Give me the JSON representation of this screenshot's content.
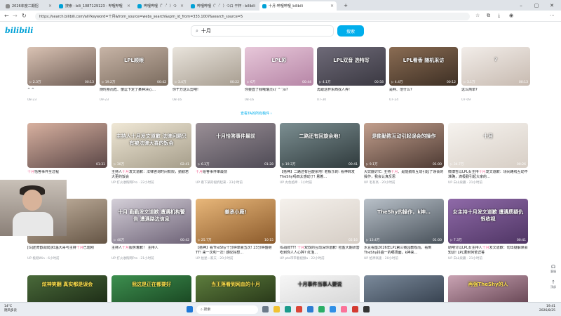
{
  "tabs": [
    {
      "label": "2026年度二期招",
      "color": "#8c8c8c"
    },
    {
      "label": "搜索 - bili_1087129123 - 哔哩哔哩",
      "color": "#00a1d6"
    },
    {
      "label": "哔哩哔哩（゜-゜）つ",
      "color": "#00a1d6"
    },
    {
      "label": "哔哩哔哩（゜-゜）つロ 干杯 - bilibili",
      "color": "#00a1d6"
    },
    {
      "label": "十月-哔哩哔哩_bilibili",
      "color": "#00a1d6"
    }
  ],
  "url": "https://search.bilibili.com/all?keyword=十月&from_source=webs_search&spm_id_from=333.1007&search_source=5",
  "logo": "bilibili",
  "search": {
    "query": "十月",
    "button": "搜索"
  },
  "row1": [
    {
      "title": "^ ^",
      "date": "08-23",
      "views": "2.3万",
      "dur": "00:13",
      "colors": [
        "#d9c2b3",
        "#6e5d55"
      ]
    },
    {
      "title": "随时身而危、傻逗下定了某种决心…",
      "date": "09-23",
      "views": "19.2万",
      "dur": "00:42",
      "colors": [
        "#c7b4a6",
        "#7a6b5e"
      ]
    },
    {
      "title": "你干万这么剪吧!",
      "date": "08-16",
      "views": "3.4万",
      "dur": "00:22",
      "colors": [
        "#e9e4dc",
        "#a79d90"
      ]
    },
    {
      "title": "你要直了我哦瑞灵ε(´^`)o?",
      "date": "08-16",
      "views": "6万",
      "dur": "00:44",
      "colors": [
        "#e7c7d9",
        "#b685a6"
      ]
    },
    {
      "title": "再跟这杯东西找人弄!",
      "date": "07-30",
      "views": "4.1万",
      "dur": "00:58",
      "colors": [
        "#6e6a78",
        "#3a3841"
      ]
    },
    {
      "title": "是啊、范什么?",
      "date": "07-24",
      "views": "4.4万",
      "dur": "00:12",
      "colors": [
        "#8a6c53",
        "#3d2f24"
      ]
    },
    {
      "title": "这么简单?",
      "date": "07-09",
      "views": "3.1万",
      "dur": "00:13",
      "colors": [
        "#f2ede9",
        "#c7bab0"
      ]
    }
  ],
  "row1_overlays": [
    "",
    "LPL顺眼",
    "",
    "LPL彩",
    "LPL双音 选特写",
    "LPL看香 随机采访",
    "?"
  ],
  "more_label": "查看TA的所有稿件 ›",
  "row2": [
    {
      "pre": "",
      "hl": "十月",
      "post": "恰答事件全过程",
      "uploader": "",
      "date": "",
      "views": "",
      "dur": "01:31",
      "ov": "",
      "colors": [
        "#d8b1a0",
        "#5a4646"
      ]
    },
    {
      "pre": "主持人",
      "hl": "十月",
      "post": "发文道歉：法律咨询时间有限，勤勤若大更的饭会",
      "uploader": "打火收购网Pro",
      "date": "22小时前",
      "views": "30万",
      "dur": "02:41",
      "ov": "主持人十月发文道歉 法律问题只有被法律大喜的饭会",
      "colors": [
        "#f0e8d6",
        "#a59d8a"
      ]
    },
    {
      "pre": "",
      "hl": "十月",
      "post": "给答事件审最前",
      "uploader": "看下某的视折起来",
      "date": "23小时前",
      "views": "6.3万",
      "dur": "01:28",
      "ov": "十月恰答事件最前",
      "colors": [
        "#9a8f96",
        "#4e4a55"
      ]
    },
    {
      "pre": "【拾神】二路还有回旋余地! 老板乐的: 看神转发TheShy吗四太感动了! 悬着…",
      "hl": "",
      "post": "",
      "uploader": "丸色拾神",
      "date": "1小时前",
      "views": "19.3万",
      "dur": "00:41",
      "ov": "二路还有回旋余地!",
      "colors": [
        "#7c8f92",
        "#2f3a3c"
      ]
    },
    {
      "pre": "大饮翻讨忙: 主持",
      "hl": "十月",
      "post": "、是能勤陈互动引起了误会的操作，我会认真反思",
      "uploader": "毛有高",
      "date": "20小时前",
      "views": "9.1万",
      "dur": "01:00",
      "ov": "是能勤陈互动引起误会的操作",
      "colors": [
        "#c29f8d",
        "#4d3a33"
      ]
    },
    {
      "pre": "微博告以LPL女主持",
      "hl": "十月",
      "post": "发文道歉：场间路线互动不准确，滴极勤引起大家的…",
      "uploader": "白山泉藏",
      "date": "21小时前",
      "views": "34.7万",
      "dur": "00:26",
      "ov": "十月",
      "colors": [
        "#f6f3ef",
        "#d7cec5"
      ]
    }
  ],
  "row3": [
    {
      "pre": "[G]还奇欧战局]红温大哥与主持",
      "hl": "十月",
      "post": "已炮刚",
      "uploader": "极刚Win",
      "date": "6小时前",
      "views": "",
      "dur": "",
      "ov": "",
      "colors": [
        "#c9b8a5",
        "#655545"
      ]
    },
    {
      "pre": "主持人",
      "hl": "十月",
      "post": "服务着歉！ 主持人",
      "uploader": "打火收购网Pro",
      "date": "21小时前",
      "views": "40万",
      "dur": "00:42",
      "ov": "十月 勤勤发文道歉 遭遇机构警告 遭遇路边信息",
      "colors": [
        "#d4cfd8",
        "#6f6478"
      ]
    },
    {
      "pre": "【拾神】看TheShy十分钟单悬五次! 23分钟盛继TT! 来一次利一次! 感叹好想…",
      "hl": "",
      "post": "",
      "uploader": "拾星一家天",
      "date": "20小时前",
      "views": "25.7万",
      "dur": "10:15",
      "ov": "姜承小鹿!",
      "colors": [
        "#e8b77a",
        "#8b5a2b"
      ]
    },
    {
      "pre": "IG战败TT! ",
      "hl": "十月",
      "post": "双双的互动深你道歉! 检盐大期研害吃到你人人心碎? 红泡…",
      "uploader": "pta带带着视频a",
      "date": "22小时前",
      "views": "",
      "dur": "02:16",
      "ov": "",
      "colors": [
        "#f5f1ec",
        "#d5cdc5"
      ]
    },
    {
      "pre": "水豆看座2026年LPL第三赛园教观而，看到TheShy抖遍一的哪场面，k神来…",
      "hl": "",
      "post": "",
      "uploader": "拾神高速",
      "date": "20小时前",
      "views": "13.4万",
      "dur": "01:00",
      "ov": "TheShy的操作，k神…",
      "colors": [
        "#b9c1c9",
        "#48515a"
      ]
    },
    {
      "pre": "助吧讨以LPL女主持人",
      "hl": "十月",
      "post": "发文道歉：切出疑解读会知识! LPL遭到何苦详答",
      "uploader": "白山泉藏",
      "date": "21小时前",
      "views": "7.3万",
      "dur": "00:41",
      "ov": "女主持十月发文道歉 遭遇质疑仇恨收视",
      "colors": [
        "#8f6aa8",
        "#4f3564"
      ]
    }
  ],
  "row4_overlays": [
    "炫神笑翻 真实都是误会",
    "我这是正在都要好",
    "当王落看到网血的十月",
    "十月事件当事人要说",
    "",
    "再强TheShy的人",
    "十月事件"
  ],
  "side": [
    {
      "label": "客服"
    },
    {
      "label": "顶部"
    }
  ],
  "taskbar": {
    "weather_line1": "14°C",
    "weather_line2": "阴风多云",
    "search_placeholder": "搜索",
    "time": "19:41",
    "date": "2026/8/25"
  }
}
